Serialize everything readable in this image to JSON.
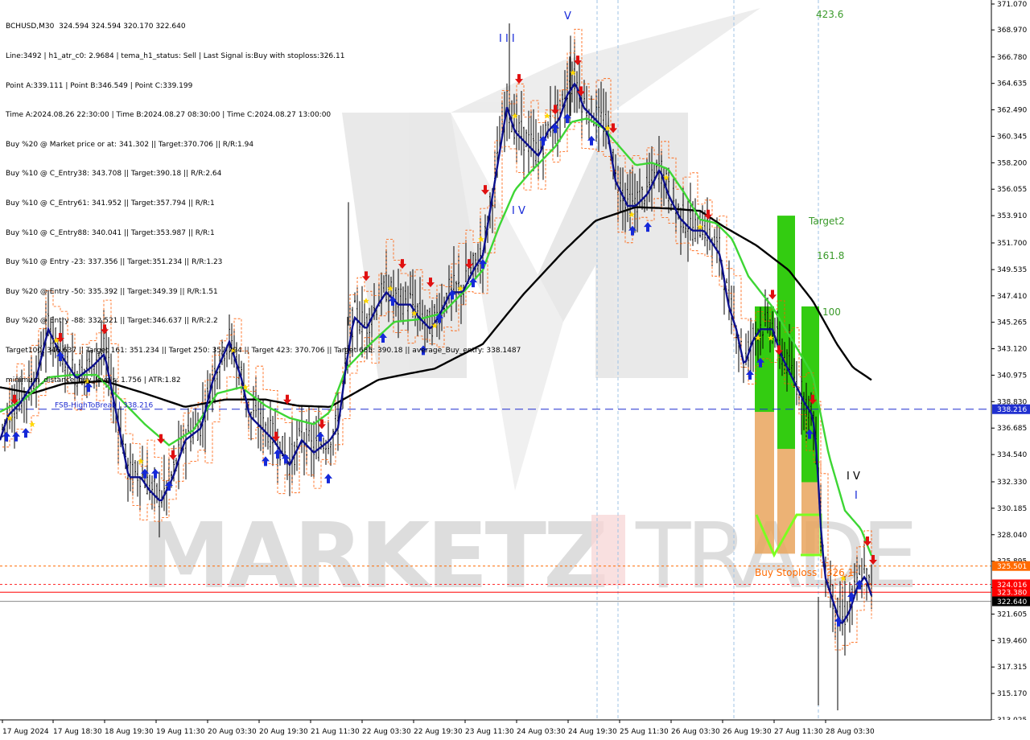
{
  "header": {
    "symbol_line": "BCHUSD,M30  324.594 324.594 320.170 322.640",
    "lines": [
      "Line:3492 | h1_atr_c0: 2.9684 | tema_h1_status: Sell | Last Signal is:Buy with stoploss:326.11",
      "Point A:339.111 | Point B:346.549 | Point C:339.199",
      "Time A:2024.08.26 22:30:00 | Time B:2024.08.27 08:30:00 | Time C:2024.08.27 13:00:00",
      "Buy %20 @ Market price or at: 341.302 || Target:370.706 || R/R:1.94",
      "Buy %10 @ C_Entry38: 343.708 || Target:390.18 || R/R:2.64",
      "Buy %10 @ C_Entry61: 341.952 || Target:357.794 || R/R:1",
      "Buy %10 @ C_Entry88: 340.041 || Target:353.987 || R/R:1",
      "Buy %10 @ Entry -23: 337.356 || Target:351.234 || R/R:1.23",
      "Buy %20 @ Entry -50: 335.392 || Target:349.39 || R/R:1.51",
      "Buy %20 @ Entry -88: 332.521 || Target:346.637 || R/R:2.2",
      "Target100: 346.637 || Target 161: 351.234 || Target 250: 357.794 || Target 423: 370.706 || Target 685: 390.18 || average_Buy_entry: 338.1487",
      "minimum_distance_buy_levels: 1.756 | ATR:1.82"
    ]
  },
  "chart_data": {
    "type": "candlestick",
    "symbol": "BCHUSD",
    "timeframe": "M30",
    "ylim": [
      313.025,
      371.07
    ],
    "y_ticks": [
      "371.070",
      "368.970",
      "366.780",
      "364.635",
      "362.490",
      "360.345",
      "358.200",
      "356.055",
      "353.910",
      "351.700",
      "349.535",
      "347.410",
      "345.265",
      "343.120",
      "340.975",
      "338.830",
      "336.685",
      "334.540",
      "332.330",
      "330.185",
      "328.040",
      "325.895",
      "323.750",
      "321.605",
      "319.460",
      "317.315",
      "315.170",
      "313.025"
    ],
    "x_ticks": [
      "17 Aug 2024",
      "17 Aug 18:30",
      "18 Aug 19:30",
      "19 Aug 11:30",
      "20 Aug 03:30",
      "20 Aug 19:30",
      "21 Aug 11:30",
      "22 Aug 03:30",
      "22 Aug 19:30",
      "23 Aug 11:30",
      "24 Aug 03:30",
      "24 Aug 19:30",
      "25 Aug 11:30",
      "26 Aug 03:30",
      "26 Aug 19:30",
      "27 Aug 11:30",
      "28 Aug 03:30"
    ],
    "price_labels": [
      {
        "text": "338.216",
        "value": 338.216,
        "color": "#2030d0"
      },
      {
        "text": "325.501",
        "value": 325.501,
        "color": "#ff6a00"
      },
      {
        "text": "324.016",
        "value": 324.016,
        "color": "#ff0000"
      },
      {
        "text": "323.380",
        "value": 323.38,
        "color": "#ff0000"
      },
      {
        "text": "322.640",
        "value": 322.64,
        "color": "#000000"
      }
    ],
    "annotations": {
      "fsb_label": "FSB-HighToBreak | 338.216",
      "fib_423": "423.6",
      "target2": "Target2",
      "fib_161": "161.8",
      "fib_100": "100",
      "buy_stoploss": "Buy Stoploss | 326.1",
      "wave_labels": [
        "V",
        "I I I",
        "I V",
        "I V",
        "I"
      ]
    },
    "series": {
      "price_knots": [
        [
          0,
          336
        ],
        [
          10,
          338
        ],
        [
          25,
          339
        ],
        [
          45,
          341
        ],
        [
          60,
          345
        ],
        [
          75,
          343
        ],
        [
          95,
          341
        ],
        [
          115,
          342
        ],
        [
          130,
          343
        ],
        [
          145,
          338
        ],
        [
          160,
          333
        ],
        [
          175,
          333
        ],
        [
          185,
          332
        ],
        [
          200,
          331
        ],
        [
          215,
          333
        ],
        [
          230,
          336
        ],
        [
          250,
          337
        ],
        [
          265,
          341
        ],
        [
          285,
          344
        ],
        [
          300,
          341
        ],
        [
          310,
          338
        ],
        [
          325,
          337
        ],
        [
          340,
          336
        ],
        [
          360,
          334
        ],
        [
          375,
          336
        ],
        [
          390,
          335
        ],
        [
          410,
          336
        ],
        [
          420,
          337
        ],
        [
          430,
          342
        ],
        [
          440,
          346
        ],
        [
          455,
          345
        ],
        [
          470,
          347
        ],
        [
          480,
          348
        ],
        [
          495,
          347
        ],
        [
          510,
          347
        ],
        [
          520,
          346
        ],
        [
          535,
          345
        ],
        [
          545,
          346
        ],
        [
          560,
          348
        ],
        [
          575,
          348
        ],
        [
          590,
          350
        ],
        [
          600,
          351
        ],
        [
          610,
          355
        ],
        [
          620,
          359
        ],
        [
          630,
          363
        ],
        [
          640,
          361
        ],
        [
          655,
          360
        ],
        [
          670,
          359
        ],
        [
          680,
          361
        ],
        [
          695,
          362
        ],
        [
          705,
          364
        ],
        [
          715,
          365
        ],
        [
          725,
          363
        ],
        [
          740,
          362
        ],
        [
          755,
          361
        ],
        [
          765,
          357
        ],
        [
          780,
          355
        ],
        [
          790,
          355
        ],
        [
          805,
          356
        ],
        [
          820,
          358
        ],
        [
          830,
          356
        ],
        [
          845,
          354
        ],
        [
          860,
          353
        ],
        [
          875,
          353
        ],
        [
          885,
          352
        ],
        [
          895,
          351
        ],
        [
          905,
          347
        ],
        [
          915,
          345
        ],
        [
          925,
          342
        ],
        [
          935,
          344
        ],
        [
          945,
          345
        ],
        [
          960,
          345
        ],
        [
          970,
          343
        ],
        [
          985,
          341
        ],
        [
          1000,
          339
        ],
        [
          1010,
          338
        ],
        [
          1015,
          335
        ],
        [
          1020,
          329
        ],
        [
          1025,
          325
        ],
        [
          1035,
          323
        ],
        [
          1045,
          321
        ],
        [
          1055,
          322
        ],
        [
          1065,
          324
        ],
        [
          1075,
          325
        ],
        [
          1085,
          323
        ]
      ],
      "ma_slow_knots": [
        [
          0,
          340
        ],
        [
          40,
          339.5
        ],
        [
          80,
          340.3
        ],
        [
          130,
          340.5
        ],
        [
          180,
          339.5
        ],
        [
          230,
          338.4
        ],
        [
          280,
          339
        ],
        [
          330,
          339
        ],
        [
          370,
          338.5
        ],
        [
          410,
          338.4
        ],
        [
          440,
          339.5
        ],
        [
          470,
          340.6
        ],
        [
          500,
          341
        ],
        [
          540,
          341.5
        ],
        [
          600,
          343.5
        ],
        [
          650,
          347.5
        ],
        [
          700,
          351
        ],
        [
          740,
          353.5
        ],
        [
          790,
          354.6
        ],
        [
          830,
          354.5
        ],
        [
          870,
          354.3
        ],
        [
          900,
          353
        ],
        [
          940,
          351.5
        ],
        [
          980,
          349.5
        ],
        [
          1010,
          347
        ],
        [
          1040,
          343.5
        ],
        [
          1060,
          341.6
        ],
        [
          1085,
          340.5
        ]
      ],
      "ma_fast_knots": [
        [
          0,
          338
        ],
        [
          30,
          339
        ],
        [
          60,
          340.8
        ],
        [
          90,
          341
        ],
        [
          120,
          341
        ],
        [
          150,
          339
        ],
        [
          180,
          337
        ],
        [
          210,
          335.3
        ],
        [
          240,
          336.5
        ],
        [
          270,
          339.5
        ],
        [
          300,
          340
        ],
        [
          330,
          338.5
        ],
        [
          360,
          337.5
        ],
        [
          390,
          337
        ],
        [
          410,
          338
        ],
        [
          430,
          341.5
        ],
        [
          460,
          343.5
        ],
        [
          490,
          345.3
        ],
        [
          520,
          345.5
        ],
        [
          550,
          346
        ],
        [
          580,
          348
        ],
        [
          600,
          349.5
        ],
        [
          620,
          353
        ],
        [
          640,
          356
        ],
        [
          660,
          357.5
        ],
        [
          690,
          359.5
        ],
        [
          710,
          361.5
        ],
        [
          730,
          361.8
        ],
        [
          750,
          361
        ],
        [
          770,
          359.5
        ],
        [
          790,
          358
        ],
        [
          810,
          358.2
        ],
        [
          830,
          357.7
        ],
        [
          850,
          355.8
        ],
        [
          870,
          353.6
        ],
        [
          890,
          353.3
        ],
        [
          910,
          352
        ],
        [
          930,
          349
        ],
        [
          960,
          346.5
        ],
        [
          990,
          343.2
        ],
        [
          1010,
          341
        ],
        [
          1030,
          334.5
        ],
        [
          1050,
          330
        ],
        [
          1070,
          328.5
        ],
        [
          1085,
          326
        ]
      ]
    },
    "bars": [
      {
        "label": "Target2",
        "color": "#33cc11",
        "top": 353.91,
        "bottom": 335
      },
      {
        "label": "100",
        "color": "#33cc11",
        "top": 346.549,
        "bottom": 330.5
      },
      {
        "label": "fib_green",
        "color": "#33cc11",
        "top": 346.549,
        "bottom": 338
      },
      {
        "label": "orange_zone",
        "color": "#e9a45d",
        "top": 338.5,
        "bottom": 326.5
      }
    ]
  }
}
